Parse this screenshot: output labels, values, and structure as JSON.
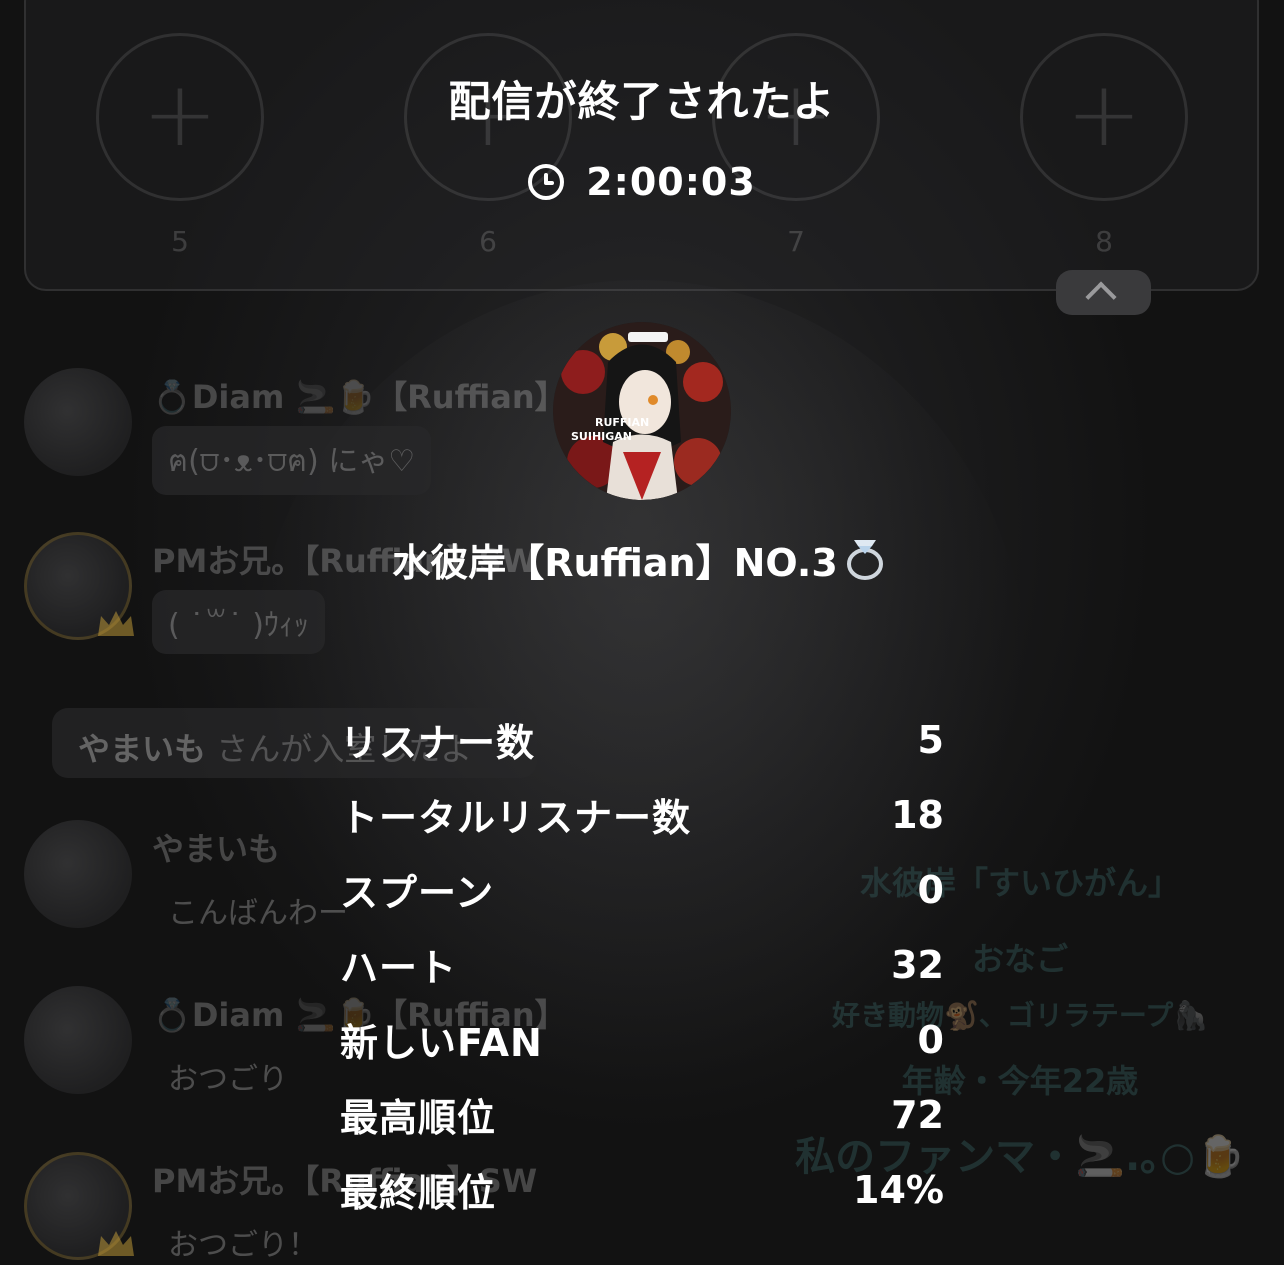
{
  "slots": [
    {
      "number": "5"
    },
    {
      "number": "6"
    },
    {
      "number": "7"
    },
    {
      "number": "8"
    }
  ],
  "end": {
    "title": "配信が終了されたよ",
    "duration": "2:00:03"
  },
  "chat": [
    {
      "name": "💍Diam 🚬🍺【Ruffian】",
      "message": "ฅ(⩌･ᴥ･⩌ฅ) にゃ♡"
    },
    {
      "name": "PMお兄。【Ruffian】SW",
      "message": "( ˙꒳˙ )ｳｨｯ"
    },
    {
      "name": "やまいも",
      "message": "こんばんわー"
    },
    {
      "name": "💍Diam 🚬🍺【Ruffian】",
      "message": "おつごり"
    },
    {
      "name": "PMお兄。【Ruffian】SW",
      "message": "おつごり！"
    }
  ],
  "join_notice": {
    "user": "やまいも",
    "text": " さんが入室したよ"
  },
  "profile_lines": [
    "水彼岸「すいひがん」",
    "おなご",
    "好き動物🐒、ゴリラテープ🦍",
    "年齢・今年22歳",
    "私のファンマ・🚬.｡○🍺"
  ],
  "streamer": {
    "avatar_text_1": "RUFFIAN",
    "avatar_text_2": "SUIHIGAN",
    "name": "水彼岸【Ruffian】NO.3"
  },
  "stats": [
    {
      "label": "リスナー数",
      "value": "5"
    },
    {
      "label": "トータルリスナー数",
      "value": "18"
    },
    {
      "label": "スプーン",
      "value": "0"
    },
    {
      "label": "ハート",
      "value": "32"
    },
    {
      "label": "新しいFAN",
      "value": "0"
    },
    {
      "label": "最高順位",
      "value": "72"
    },
    {
      "label": "最終順位",
      "value": "14%"
    }
  ]
}
